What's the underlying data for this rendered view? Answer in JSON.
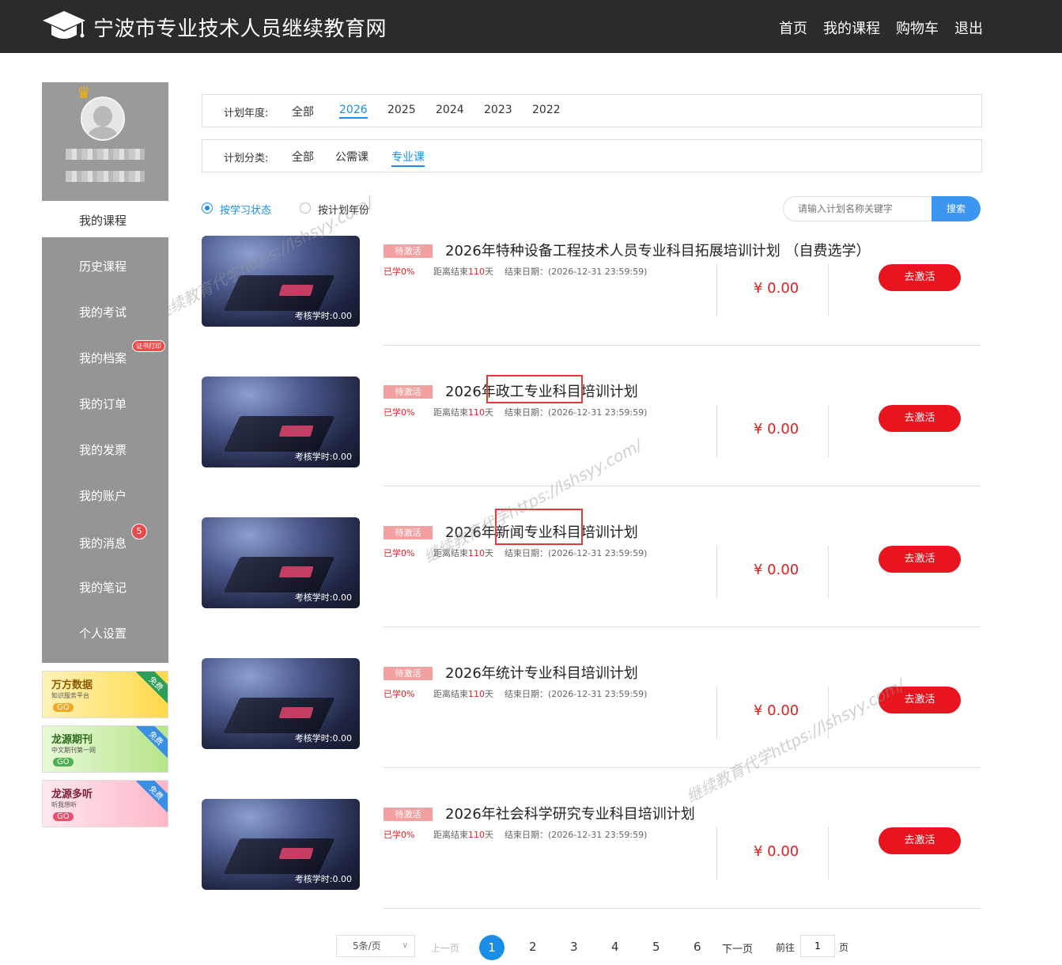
{
  "header": {
    "site_title": "宁波市专业技术人员继续教育网",
    "nav": [
      "首页",
      "我的课程",
      "购物车",
      "退出"
    ]
  },
  "sidebar": {
    "current": "我的课程",
    "items": [
      "历史课程",
      "我的考试",
      "我的档案",
      "我的订单",
      "我的发票",
      "我的账户",
      "我的消息",
      "我的笔记",
      "个人设置"
    ],
    "cert_tag": "证书打印",
    "message_badge": "5",
    "ads": [
      {
        "title": "万方数据",
        "subtitle": "知识服务平台",
        "go": "GO",
        "free": "免费"
      },
      {
        "title": "龙源期刊",
        "subtitle": "中文期刊第一网",
        "go": "GO",
        "free": "免费"
      },
      {
        "title": "龙源多听",
        "subtitle": "听我想听",
        "go": "GO",
        "free": "免费"
      }
    ]
  },
  "filters": {
    "year_label": "计划年度:",
    "years": [
      "全部",
      "2026",
      "2025",
      "2024",
      "2023",
      "2022"
    ],
    "year_active": "2026",
    "category_label": "计划分类:",
    "categories": [
      "全部",
      "公需课",
      "专业课"
    ],
    "category_active": "专业课",
    "sort_options": [
      "按学习状态",
      "按计划年份"
    ],
    "sort_active": "按学习状态",
    "search_placeholder": "请输入计划名称关键字",
    "search_button": "搜索"
  },
  "courses": [
    {
      "status": "待激活",
      "title": "2026年特种设备工程技术人员专业科目拓展培训计划 （自费选学）",
      "learned": "已学0%",
      "remain_prefix": "距离结束",
      "remain_days": "110",
      "remain_suffix": "天",
      "end_date": "结束日期：(2026-12-31 23:59:59)",
      "price": "¥ 0.00",
      "hours": "考核学时:0.00",
      "action": "去激活"
    },
    {
      "status": "待激活",
      "title": "2026年政工专业科目培训计划",
      "learned": "已学0%",
      "remain_prefix": "距离结束",
      "remain_days": "110",
      "remain_suffix": "天",
      "end_date": "结束日期：(2026-12-31 23:59:59)",
      "price": "¥ 0.00",
      "hours": "考核学时:0.00",
      "action": "去激活"
    },
    {
      "status": "待激活",
      "title": "2026年新闻专业科目培训计划",
      "learned": "已学0%",
      "remain_prefix": "距离结束",
      "remain_days": "110",
      "remain_suffix": "天",
      "end_date": "结束日期：(2026-12-31 23:59:59)",
      "price": "¥ 0.00",
      "hours": "考核学时:0.00",
      "action": "去激活"
    },
    {
      "status": "待激活",
      "title": "2026年统计专业科目培训计划",
      "learned": "已学0%",
      "remain_prefix": "距离结束",
      "remain_days": "110",
      "remain_suffix": "天",
      "end_date": "结束日期：(2026-12-31 23:59:59)",
      "price": "¥ 0.00",
      "hours": "考核学时:0.00",
      "action": "去激活"
    },
    {
      "status": "待激活",
      "title": "2026年社会科学研究专业科目培训计划",
      "learned": "已学0%",
      "remain_prefix": "距离结束",
      "remain_days": "110",
      "remain_suffix": "天",
      "end_date": "结束日期：(2026-12-31 23:59:59)",
      "price": "¥ 0.00",
      "hours": "考核学时:0.00",
      "action": "去激活"
    }
  ],
  "pagination": {
    "page_size": "5条/页",
    "prev": "上一页",
    "pages": [
      "1",
      "2",
      "3",
      "4",
      "5",
      "6"
    ],
    "current": "1",
    "next": "下一页",
    "goto_prefix": "前往",
    "goto_value": "1",
    "goto_suffix": "页"
  },
  "watermark": "继续教育代学https://lshsyy.com/",
  "colors": {
    "accent": "#1a8ee6",
    "danger": "#e8141e",
    "header_bg": "#2b2b2b",
    "sidebar_bg": "#959595"
  }
}
